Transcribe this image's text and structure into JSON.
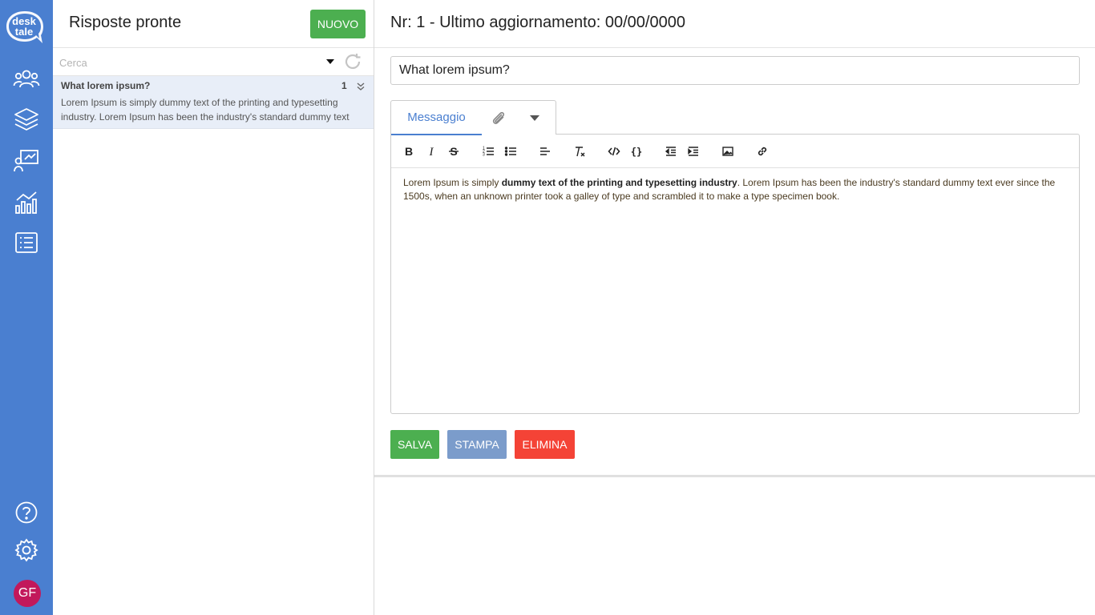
{
  "app": {
    "logo_line1": "desk",
    "logo_line2": "tale",
    "avatar_initials": "GF",
    "colors": {
      "sidebar": "#4a7fd0",
      "accent": "#4a7fd0",
      "success": "#4caf50",
      "secondary": "#7b9ccb",
      "danger": "#f44336",
      "avatar": "#c2185b"
    }
  },
  "sidebar": {
    "items": [
      {
        "icon": "users-icon"
      },
      {
        "icon": "layers-icon"
      },
      {
        "icon": "presentation-icon"
      },
      {
        "icon": "analytics-icon"
      },
      {
        "icon": "list-icon"
      }
    ],
    "bottom": [
      {
        "icon": "help-icon"
      },
      {
        "icon": "settings-icon"
      }
    ]
  },
  "list_panel": {
    "title": "Risposte pronte",
    "new_button": "NUOVO",
    "search_placeholder": "Cerca",
    "items": [
      {
        "title": "What lorem ipsum?",
        "count": "1",
        "preview": "Lorem Ipsum is simply dummy text of the printing and typesetting industry. Lorem Ipsum has been the industry's standard dummy text"
      }
    ]
  },
  "main": {
    "header": "Nr: 1 - Ultimo aggiornamento: 00/00/0000",
    "subject_value": "What lorem ipsum?",
    "tab_message": "Messaggio",
    "content": {
      "part1": "Lorem Ipsum is simply ",
      "bold": "dummy text of the printing and typesetting industry",
      "part2": ". Lorem Ipsum has been the industry's standard dummy text ever since the 1500s, when an unknown printer took a galley of type and scrambled it to make a type specimen book."
    },
    "buttons": {
      "save": "SALVA",
      "print": "STAMPA",
      "delete": "ELIMINA"
    }
  }
}
